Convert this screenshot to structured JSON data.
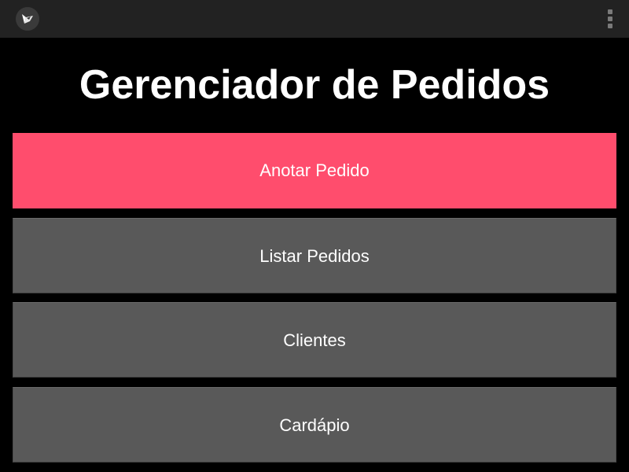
{
  "app_bar": {
    "logo_icon": "kivy-logo-icon",
    "menu_icon": "overflow-menu-icon"
  },
  "title": "Gerenciador de Pedidos",
  "buttons": [
    {
      "label": "Anotar Pedido",
      "color": "#ff4d6d"
    },
    {
      "label": "Listar Pedidos",
      "color": "#595959"
    },
    {
      "label": "Clientes",
      "color": "#595959"
    },
    {
      "label": "Cardápio",
      "color": "#595959"
    }
  ],
  "colors": {
    "background": "#000000",
    "app_bar": "#222222",
    "accent": "#ff4d6d",
    "button_default": "#595959",
    "text": "#ffffff"
  }
}
